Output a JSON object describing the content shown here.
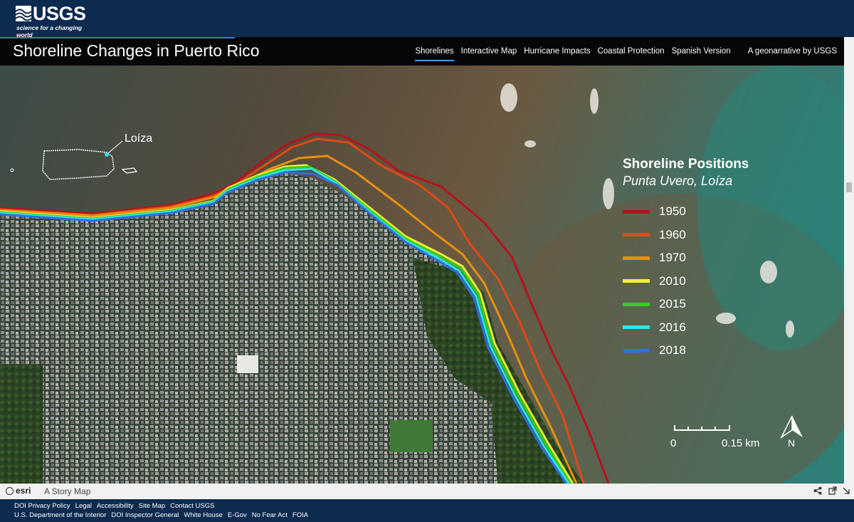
{
  "header": {
    "agency_name": "USGS",
    "agency_tagline": "science for a changing world"
  },
  "story": {
    "title": "Shoreline Changes in Puerto Rico",
    "nav": [
      {
        "label": "Shorelines",
        "active": true
      },
      {
        "label": "Interactive Map",
        "active": false
      },
      {
        "label": "Hurricane Impacts",
        "active": false
      },
      {
        "label": "Coastal Protection",
        "active": false
      },
      {
        "label": "Spanish Version",
        "active": false
      }
    ],
    "byline": "A geonarrative by USGS"
  },
  "map": {
    "inset_label": "Loíza",
    "legend": {
      "title": "Shoreline Positions",
      "subtitle": "Punta Uvero, Loíza",
      "items": [
        {
          "year": "1950",
          "color": "#b5121b"
        },
        {
          "year": "1960",
          "color": "#e04a14"
        },
        {
          "year": "1970",
          "color": "#e8900f"
        },
        {
          "year": "2010",
          "color": "#f4ef3a"
        },
        {
          "year": "2015",
          "color": "#32d21e"
        },
        {
          "year": "2016",
          "color": "#2fe3e6"
        },
        {
          "year": "2018",
          "color": "#2f6fe6"
        }
      ]
    },
    "scale": {
      "start": "0",
      "end": "0.15 km"
    },
    "north_label": "N"
  },
  "bottom_bar": {
    "esri_label": "esri",
    "storymap_label": "A Story Map"
  },
  "footer": {
    "row1": [
      "DOI Privacy Policy",
      "Legal",
      "Accessibility",
      "Site Map",
      "Contact USGS"
    ],
    "row2": [
      "U.S. Department of the Interior",
      "DOI Inspector General",
      "White House",
      "E-Gov",
      "No Fear Act",
      "FOIA"
    ]
  }
}
